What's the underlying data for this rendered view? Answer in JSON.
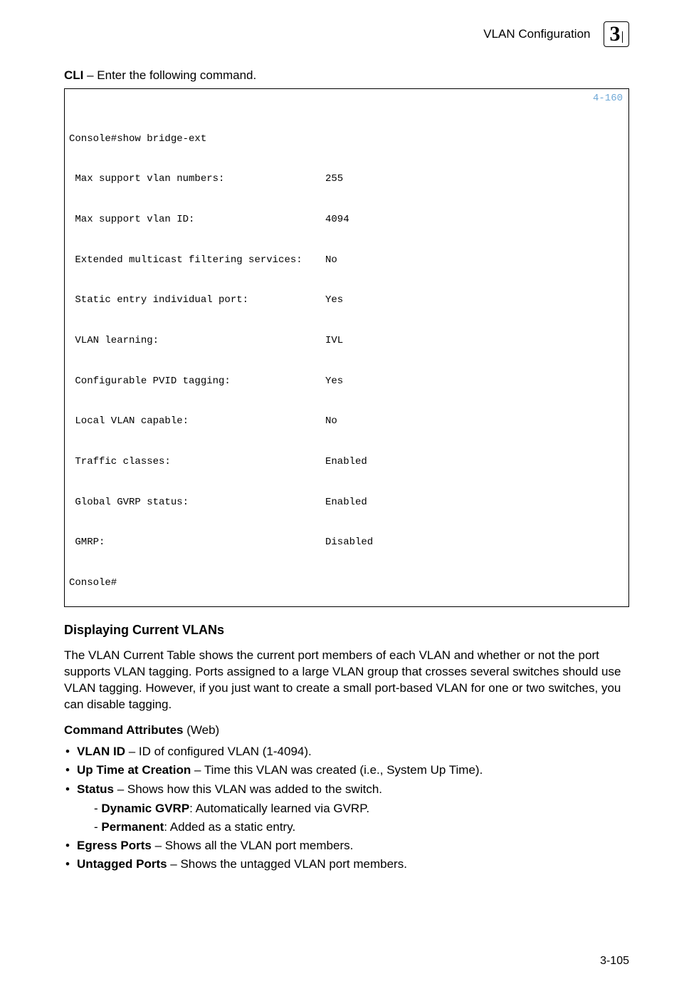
{
  "header": {
    "title": "VLAN Configuration",
    "chapter": "3"
  },
  "cli_intro": {
    "prefix": "CLI",
    "text": " – Enter the following command."
  },
  "code": {
    "ref": "4-160",
    "lines": [
      {
        "label": "Console#show bridge-ext",
        "value": ""
      },
      {
        "label": " Max support vlan numbers:",
        "value": "255"
      },
      {
        "label": " Max support vlan ID:",
        "value": "4094"
      },
      {
        "label": " Extended multicast filtering services:",
        "value": "No"
      },
      {
        "label": " Static entry individual port:",
        "value": "Yes"
      },
      {
        "label": " VLAN learning:",
        "value": "IVL"
      },
      {
        "label": " Configurable PVID tagging:",
        "value": "Yes"
      },
      {
        "label": " Local VLAN capable:",
        "value": "No"
      },
      {
        "label": " Traffic classes:",
        "value": "Enabled"
      },
      {
        "label": " Global GVRP status:",
        "value": "Enabled"
      },
      {
        "label": " GMRP:",
        "value": "Disabled"
      },
      {
        "label": "Console#",
        "value": ""
      }
    ]
  },
  "subsection": {
    "heading": "Displaying Current VLANs",
    "body": "The VLAN Current Table shows the current port members of each VLAN and whether or not the port supports VLAN tagging. Ports assigned to a large VLAN group that crosses several switches should use VLAN tagging. However, if you just want to create a small port-based VLAN for one or two switches, you can disable tagging."
  },
  "attributes": {
    "heading_bold": "Command Attributes",
    "heading_suffix": " (Web)",
    "items": [
      {
        "term": "VLAN ID",
        "desc": " – ID of configured VLAN (1-4094)."
      },
      {
        "term": "Up Time at Creation",
        "desc": " – Time this VLAN was created (i.e., System Up Time)."
      },
      {
        "term": "Status",
        "desc": " – Shows how this VLAN was added to the switch.",
        "subs": [
          {
            "term": "Dynamic GVRP",
            "desc": ": Automatically learned via GVRP."
          },
          {
            "term": "Permanent",
            "desc": ": Added as a static entry."
          }
        ]
      },
      {
        "term": "Egress Ports",
        "desc": " – Shows all the VLAN port members."
      },
      {
        "term": "Untagged Ports",
        "desc": " – Shows the untagged VLAN port members."
      }
    ]
  },
  "page_number": "3-105"
}
